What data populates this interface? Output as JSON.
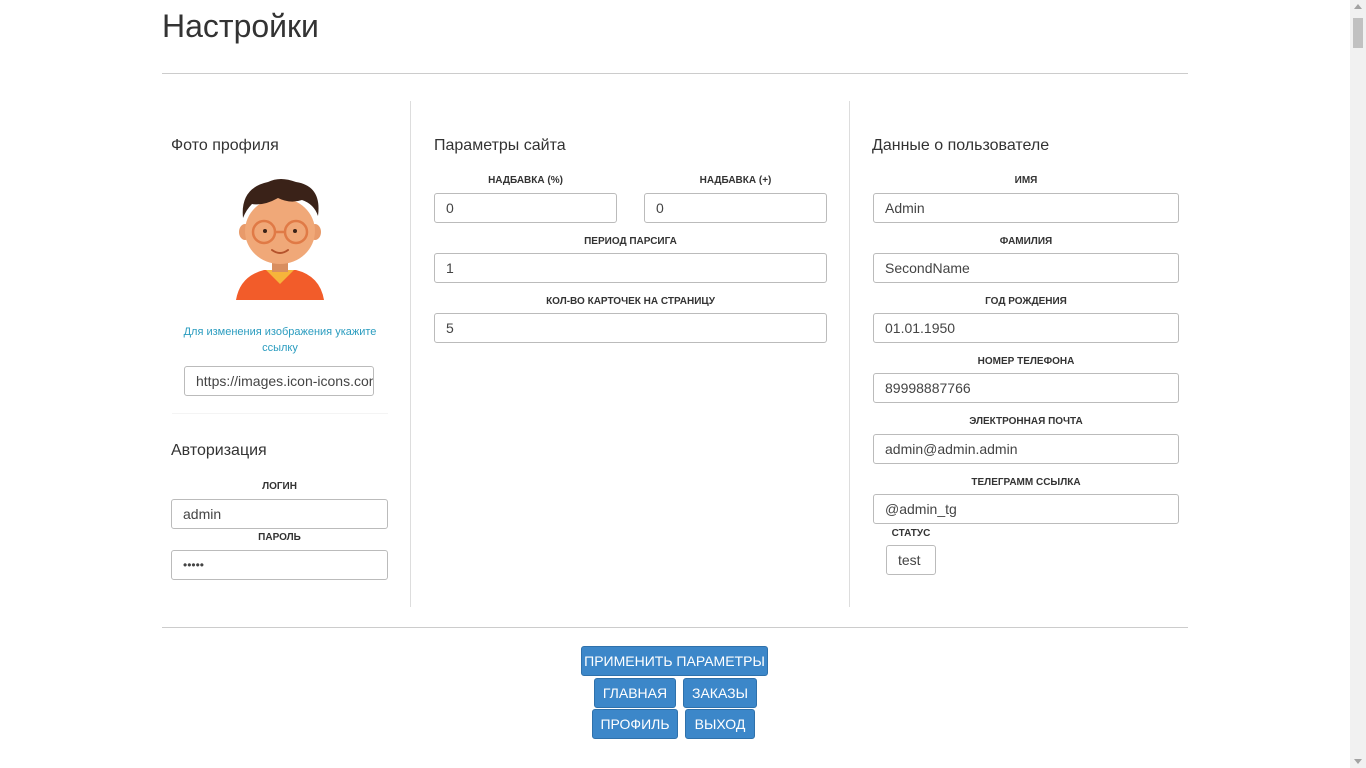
{
  "page": {
    "title": "Настройки"
  },
  "photo": {
    "title": "Фото профиля",
    "avatar_icon": "avatar-boy-with-glasses-icon",
    "hint": "Для изменения изображения укажите ссылку",
    "url_value": "https://images.icon-icons.com"
  },
  "auth": {
    "title": "Авторизация",
    "login_label": "ЛОГИН",
    "login_value": "admin",
    "password_label": "ПАРОЛЬ",
    "password_value": "•••••"
  },
  "site": {
    "title": "Параметры сайта",
    "markup_percent_label": "НАДБАВКА (%)",
    "markup_percent_value": "0",
    "markup_plus_label": "НАДБАВКА (+)",
    "markup_plus_value": "0",
    "parse_period_label": "ПЕРИОД ПАРСИГА",
    "parse_period_value": "1",
    "cards_per_page_label": "КОЛ-ВО КАРТОЧЕК НА СТРАНИЦУ",
    "cards_per_page_value": "5"
  },
  "user": {
    "title": "Данные о пользователе",
    "first_name_label": "ИМЯ",
    "first_name_value": "Admin",
    "last_name_label": "ФАМИЛИЯ",
    "last_name_value": "SecondName",
    "birth_label": "ГОД РОЖДЕНИЯ",
    "birth_value": "01.01.1950",
    "phone_label": "НОМЕР ТЕЛЕФОНА",
    "phone_value": "89998887766",
    "email_label": "ЭЛЕКТРОННАЯ ПОЧТА",
    "email_value": "admin@admin.admin",
    "telegram_label": "ТЕЛЕГРАММ ССЫЛКА",
    "telegram_value": "@admin_tg",
    "status_label": "СТАТУС",
    "status_value": "test"
  },
  "buttons": {
    "apply": "ПРИМЕНИТЬ ПАРАМЕТРЫ",
    "home": "ГЛАВНАЯ",
    "orders": "ЗАКАЗЫ",
    "profile": "ПРОФИЛЬ",
    "logout": "ВЫХОД"
  },
  "colors": {
    "accent": "#3c87c9",
    "hint": "#2a9cbf"
  }
}
